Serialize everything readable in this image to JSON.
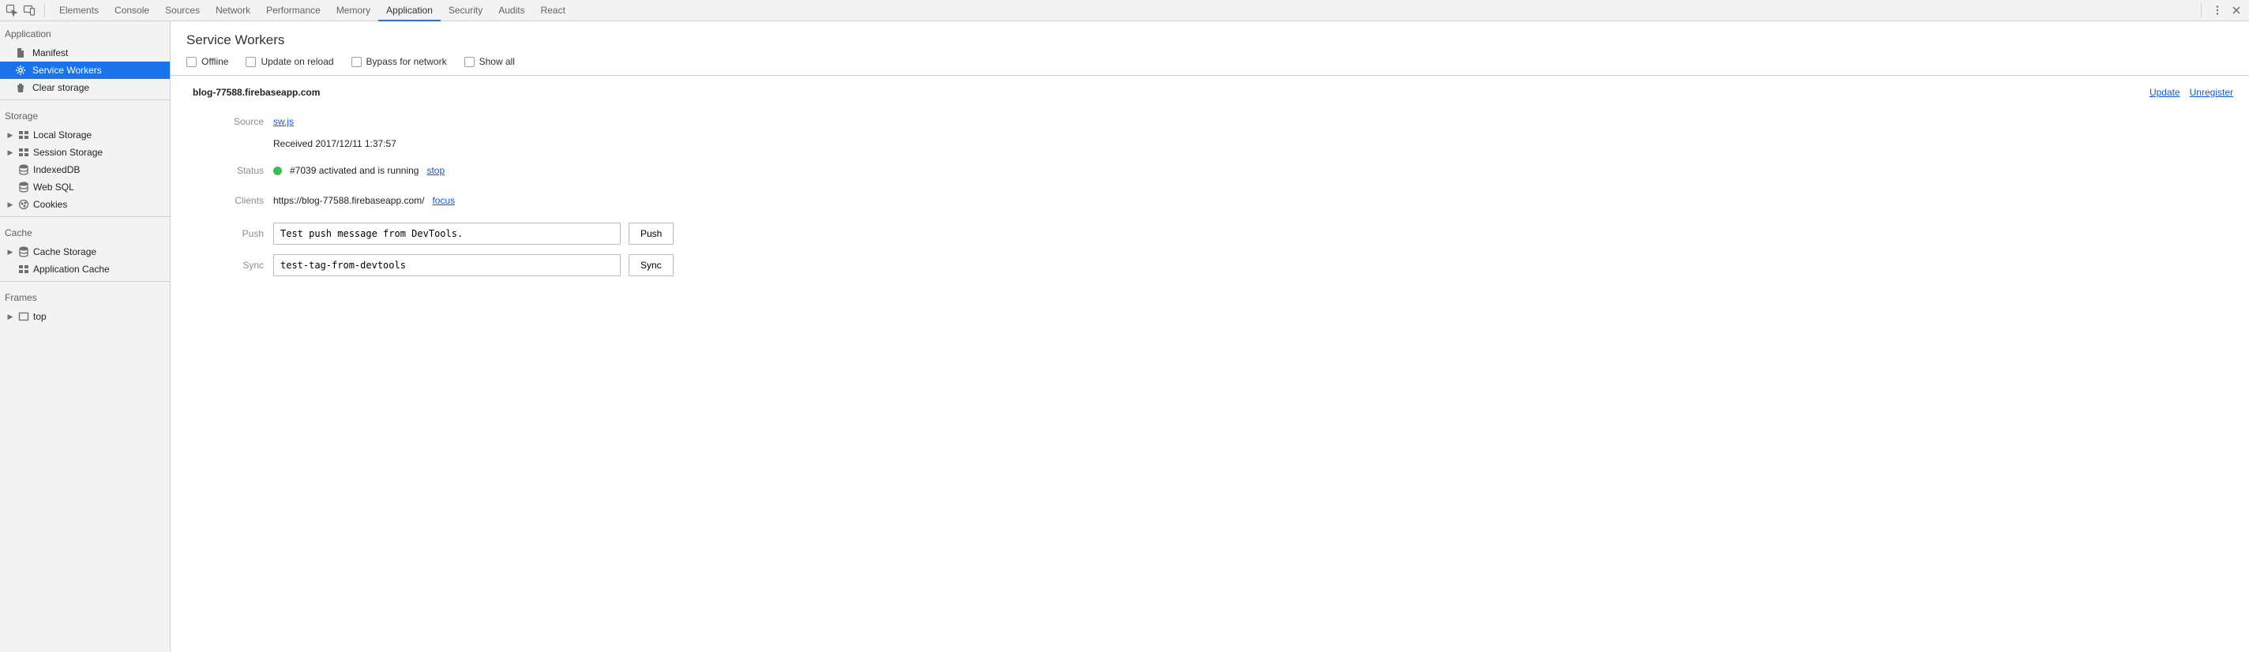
{
  "tabs": {
    "elements": "Elements",
    "console": "Console",
    "sources": "Sources",
    "network": "Network",
    "performance": "Performance",
    "memory": "Memory",
    "application": "Application",
    "security": "Security",
    "audits": "Audits",
    "react": "React"
  },
  "sidebar": {
    "application": {
      "title": "Application",
      "manifest": "Manifest",
      "service_workers": "Service Workers",
      "clear_storage": "Clear storage"
    },
    "storage": {
      "title": "Storage",
      "local_storage": "Local Storage",
      "session_storage": "Session Storage",
      "indexeddb": "IndexedDB",
      "web_sql": "Web SQL",
      "cookies": "Cookies"
    },
    "cache": {
      "title": "Cache",
      "cache_storage": "Cache Storage",
      "application_cache": "Application Cache"
    },
    "frames": {
      "title": "Frames",
      "top": "top"
    }
  },
  "panel": {
    "title": "Service Workers",
    "toolbar": {
      "offline": "Offline",
      "update_on_reload": "Update on reload",
      "bypass_for_network": "Bypass for network",
      "show_all": "Show all"
    },
    "origin": "blog-77588.firebaseapp.com",
    "actions": {
      "update": "Update",
      "unregister": "Unregister"
    },
    "rows": {
      "source": {
        "label": "Source",
        "file": "sw.js",
        "received": "Received 2017/12/11 1:37:57"
      },
      "status": {
        "label": "Status",
        "text": "#7039 activated and is running",
        "stop": "stop"
      },
      "clients": {
        "label": "Clients",
        "url": "https://blog-77588.firebaseapp.com/",
        "focus": "focus"
      },
      "push": {
        "label": "Push",
        "value": "Test push message from DevTools.",
        "button": "Push"
      },
      "sync": {
        "label": "Sync",
        "value": "test-tag-from-devtools",
        "button": "Sync"
      }
    }
  }
}
